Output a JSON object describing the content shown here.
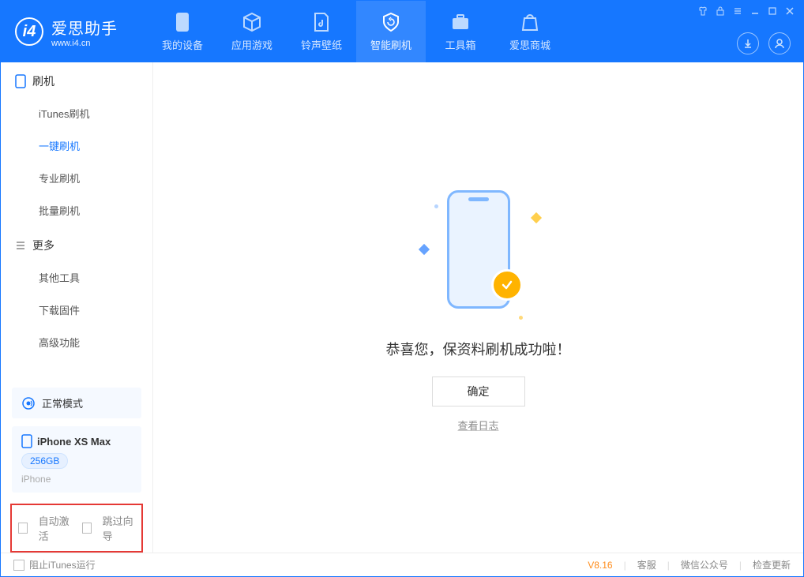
{
  "app": {
    "title": "爱思助手",
    "site": "www.i4.cn"
  },
  "nav": {
    "tabs": [
      {
        "label": "我的设备"
      },
      {
        "label": "应用游戏"
      },
      {
        "label": "铃声壁纸"
      },
      {
        "label": "智能刷机"
      },
      {
        "label": "工具箱"
      },
      {
        "label": "爱思商城"
      }
    ]
  },
  "sidebar": {
    "group1": {
      "title": "刷机",
      "items": [
        "iTunes刷机",
        "一键刷机",
        "专业刷机",
        "批量刷机"
      ],
      "activeIndex": 1
    },
    "group2": {
      "title": "更多",
      "items": [
        "其他工具",
        "下载固件",
        "高级功能"
      ]
    },
    "mode": "正常模式",
    "device": {
      "name": "iPhone XS Max",
      "capacity": "256GB",
      "type": "iPhone"
    },
    "checks": {
      "autoActivate": "自动激活",
      "skipGuide": "跳过向导"
    }
  },
  "main": {
    "success": "恭喜您，保资料刷机成功啦！",
    "ok": "确定",
    "viewLog": "查看日志"
  },
  "footer": {
    "blockItunes": "阻止iTunes运行",
    "version": "V8.16",
    "links": [
      "客服",
      "微信公众号",
      "检查更新"
    ]
  }
}
